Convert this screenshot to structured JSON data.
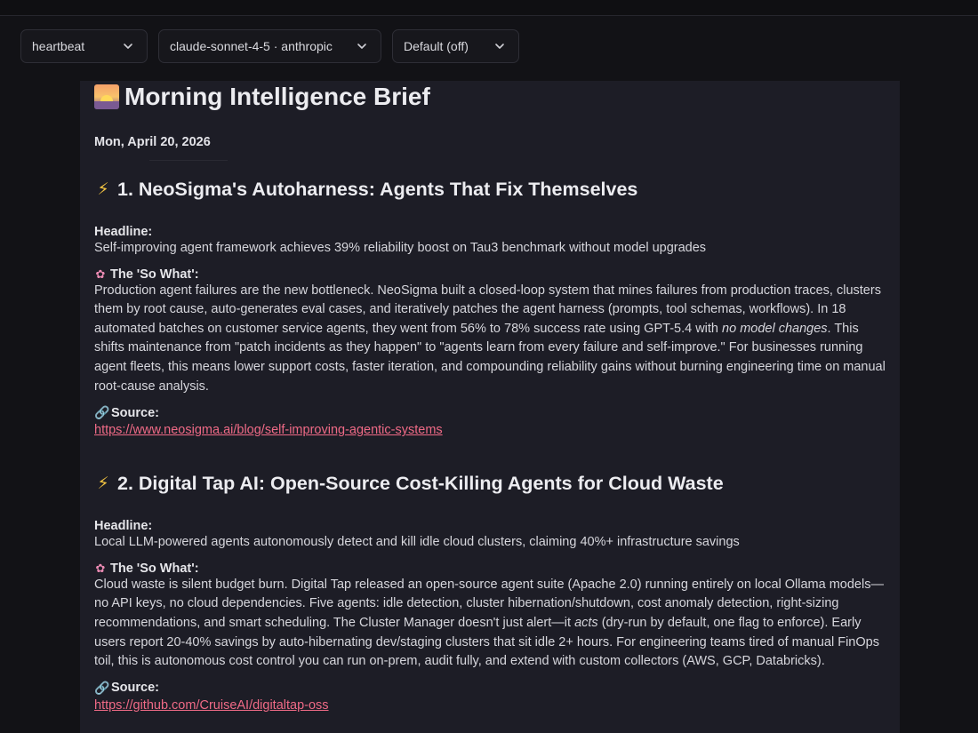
{
  "controls": {
    "agent_select": "heartbeat",
    "model_select": "claude-sonnet-4-5 · anthropic",
    "mode_select": "Default (off)"
  },
  "brief": {
    "title": "Morning Intelligence Brief",
    "date": "Mon, April 20, 2026",
    "items": [
      {
        "title": "1. NeoSigma's Autoharness: Agents That Fix Themselves",
        "headline_label": "Headline:",
        "headline": "Self-improving agent framework achieves 39% reliability boost on Tau3 benchmark without model upgrades",
        "sowhat_label": "The 'So What':",
        "sowhat_a": "Production agent failures are the new bottleneck. NeoSigma built a closed-loop system that mines failures from production traces, clusters them by root cause, auto-generates eval cases, and iteratively patches the agent harness (prompts, tool schemas, workflows). In 18 automated batches on customer service agents, they went from 56% to 78% success rate using GPT-5.4 with ",
        "sowhat_em": "no model changes",
        "sowhat_b": ". This shifts maintenance from \"patch incidents as they happen\" to \"agents learn from every failure and self-improve.\" For businesses running agent fleets, this means lower support costs, faster iteration, and compounding reliability gains without burning engineering time on manual root-cause analysis.",
        "source_label": "Source:",
        "source_url": "https://www.neosigma.ai/blog/self-improving-agentic-systems"
      },
      {
        "title": "2. Digital Tap AI: Open-Source Cost-Killing Agents for Cloud Waste",
        "headline_label": "Headline:",
        "headline": "Local LLM-powered agents autonomously detect and kill idle cloud clusters, claiming 40%+ infrastructure savings",
        "sowhat_label": "The 'So What':",
        "sowhat_a": "Cloud waste is silent budget burn. Digital Tap released an open-source agent suite (Apache 2.0) running entirely on local Ollama models—no API keys, no cloud dependencies. Five agents: idle detection, cluster hibernation/shutdown, cost anomaly detection, right-sizing recommendations, and smart scheduling. The Cluster Manager doesn't just alert—it ",
        "sowhat_em": "acts",
        "sowhat_b": " (dry-run by default, one flag to enforce). Early users report 20-40% savings by auto-hibernating dev/staging clusters that sit idle 2+ hours. For engineering teams tired of manual FinOps toil, this is autonomous cost control you can run on-prem, audit fully, and extend with custom collectors (AWS, GCP, Databricks).",
        "source_label": "Source:",
        "source_url": "https://github.com/CruiseAI/digitaltap-oss"
      }
    ]
  }
}
